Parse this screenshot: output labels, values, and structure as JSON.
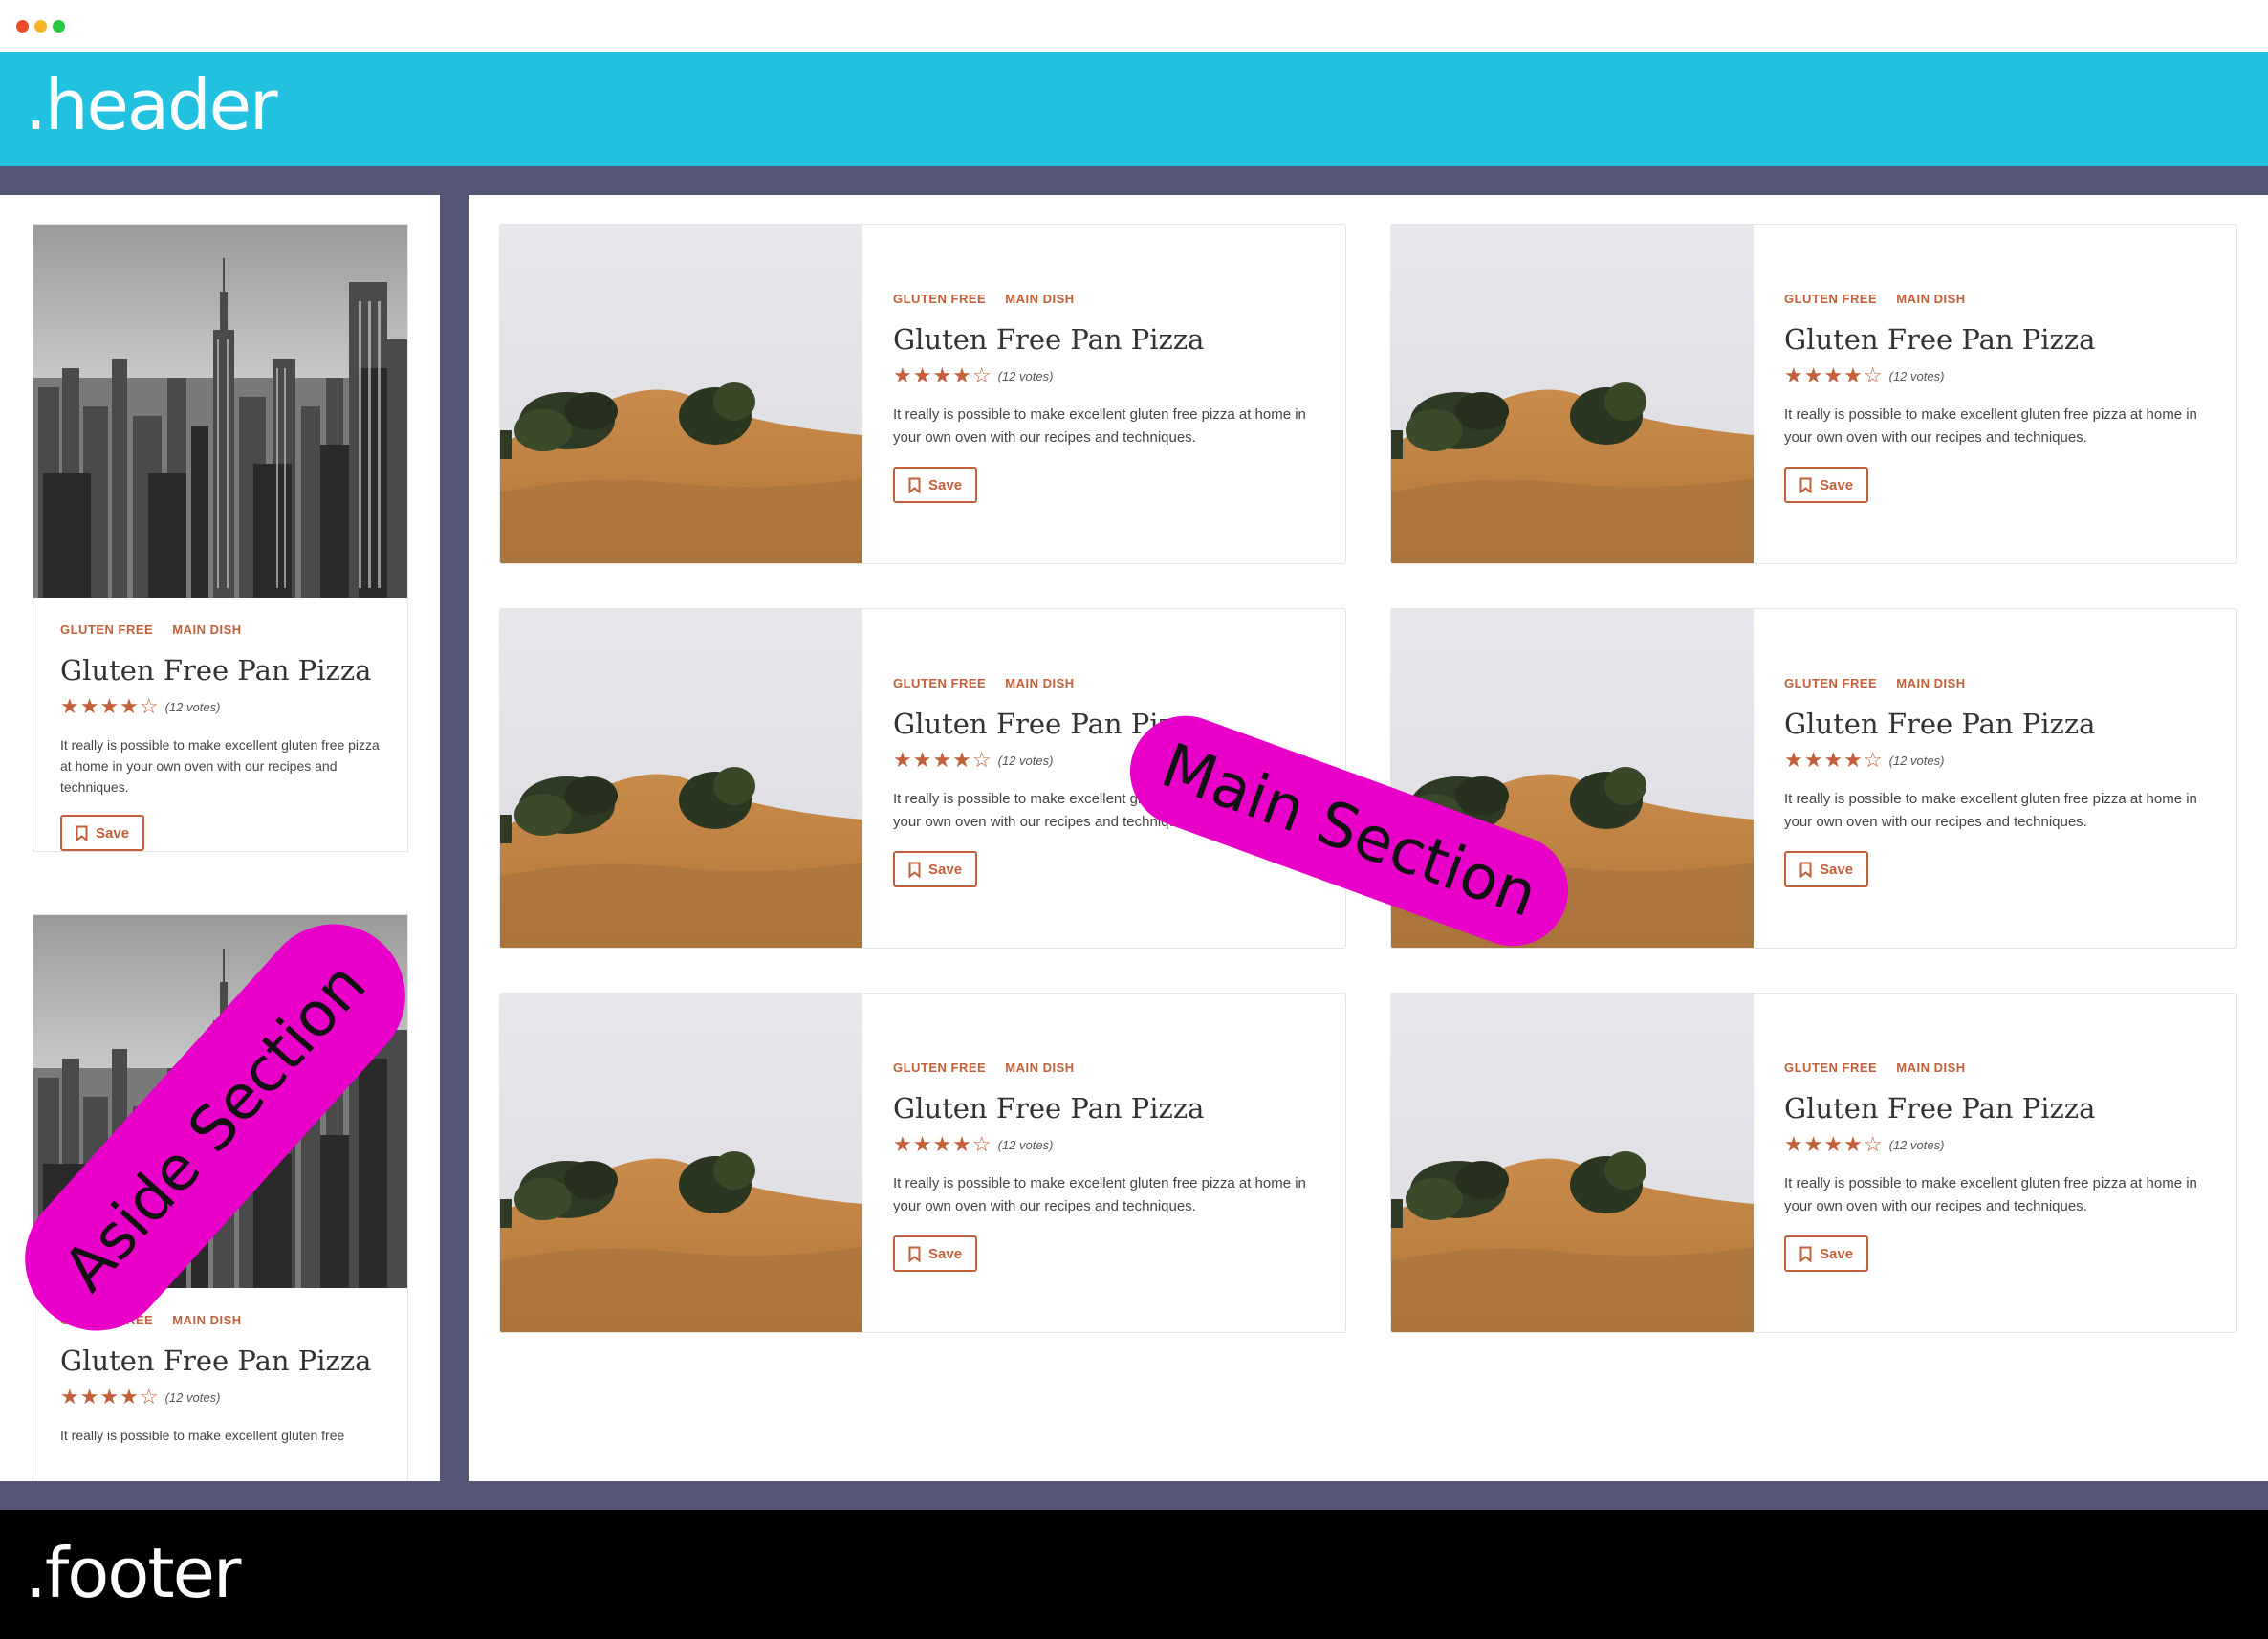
{
  "window": {
    "controls": [
      "close",
      "minimize",
      "maximize"
    ]
  },
  "header": {
    "label": ".header"
  },
  "footer": {
    "label": ".footer"
  },
  "overlays": {
    "aside_label": "Aside Section",
    "main_label": "Main Section"
  },
  "card": {
    "tag_1": "GLUTEN FREE",
    "tag_2": "MAIN DISH",
    "title": "Gluten Free Pan Pizza",
    "stars": "★★★★☆",
    "rating_stars": 4,
    "rating_max": 5,
    "votes": "(12 votes)",
    "description": "It really is possible to make excellent gluten free pizza at home in your own oven with our recipes and techniques.",
    "description_cut": "It really is possible to make excellent gluten free",
    "save_label": "Save"
  },
  "colors": {
    "header_bg": "#22c1e0",
    "frame_bg": "#555675",
    "footer_bg": "#000000",
    "accent": "#c1603a",
    "overlay": "#e800c8",
    "overlay_highlight": "#39e51e"
  },
  "icons": {
    "save": "bookmark-icon"
  }
}
